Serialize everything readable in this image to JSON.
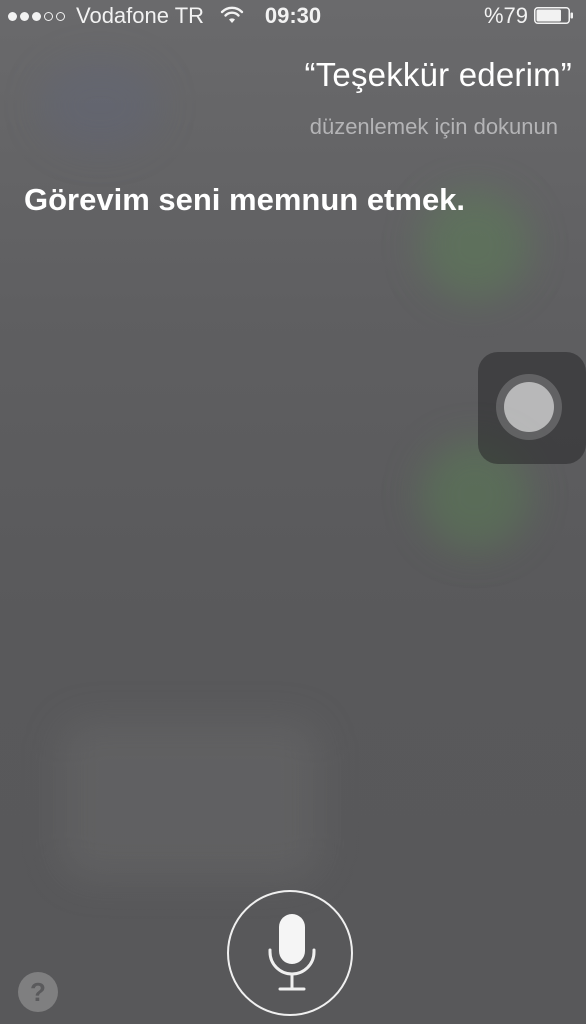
{
  "status_bar": {
    "signal_dots_filled": 3,
    "signal_dots_total": 5,
    "carrier": "Vodafone TR",
    "wifi_icon": "wifi-icon",
    "time": "09:30",
    "battery_percent": "%79",
    "battery_level": 0.79
  },
  "siri": {
    "query": "“Teşekkür ederim”",
    "edit_hint": "düzenlemek için dokunun",
    "answer": "Görevim seni memnun etmek."
  },
  "controls": {
    "mic_icon": "microphone-icon",
    "help_label": "?"
  },
  "colors": {
    "background": "#5a5a5c",
    "text": "#ffffff",
    "hint_text": "#b4b4b6"
  }
}
